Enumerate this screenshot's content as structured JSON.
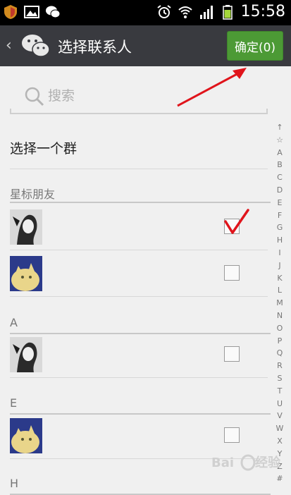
{
  "status_bar": {
    "time": "15:58",
    "icons": [
      "shield-icon",
      "image-icon",
      "wechat-icon",
      "alarm-icon",
      "wifi-icon",
      "signal-icon",
      "battery-icon"
    ]
  },
  "header": {
    "title": "选择联系人",
    "confirm_label": "确定(0)",
    "back_icon": "chevron-left-icon"
  },
  "search": {
    "placeholder": "搜索"
  },
  "group_select": {
    "label": "选择一个群"
  },
  "sections": [
    {
      "header": "星标朋友",
      "contacts": [
        {
          "name": "",
          "avatar": "avatar-portrait",
          "checked": true
        },
        {
          "name": "",
          "avatar": "avatar-cat",
          "checked": false
        }
      ]
    },
    {
      "header": "A",
      "contacts": [
        {
          "name": "",
          "avatar": "avatar-portrait",
          "checked": false
        }
      ]
    },
    {
      "header": "E",
      "contacts": [
        {
          "name": "",
          "avatar": "avatar-cat",
          "checked": false
        }
      ]
    },
    {
      "header": "H",
      "contacts": []
    }
  ],
  "alphabet_index": [
    "↑",
    "☆",
    "A",
    "B",
    "C",
    "D",
    "E",
    "F",
    "G",
    "H",
    "I",
    "J",
    "K",
    "L",
    "M",
    "N",
    "O",
    "P",
    "Q",
    "R",
    "S",
    "T",
    "U",
    "V",
    "W",
    "X",
    "Y",
    "Z",
    "#"
  ],
  "colors": {
    "titlebar": "#393a3f",
    "confirm": "#4c9a35",
    "annotation": "#e0141b"
  }
}
